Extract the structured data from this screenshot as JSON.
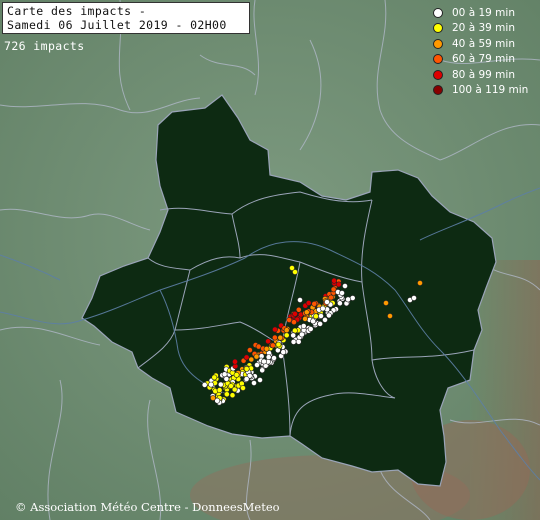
{
  "title": {
    "line1": "Carte des impacts -",
    "line2": "Samedi 06 Juillet 2019 - 02H00"
  },
  "impact_count": "726 impacts",
  "legend": [
    {
      "label": "00 à 19 min",
      "color": "#ffffff"
    },
    {
      "label": "20 à 39 min",
      "color": "#ffff00"
    },
    {
      "label": "40 à 59 min",
      "color": "#ff9900"
    },
    {
      "label": "60 à 79 min",
      "color": "#ff5500"
    },
    {
      "label": "80 à 99 min",
      "color": "#dd0000"
    },
    {
      "label": "100 à 119 min",
      "color": "#880000"
    }
  ],
  "credit": "© Association Météo Centre - DonneesMeteo",
  "colors": {
    "region_fill": "#0d2a12",
    "background": "#6f8f74",
    "borders": "#a8b0c0"
  }
}
